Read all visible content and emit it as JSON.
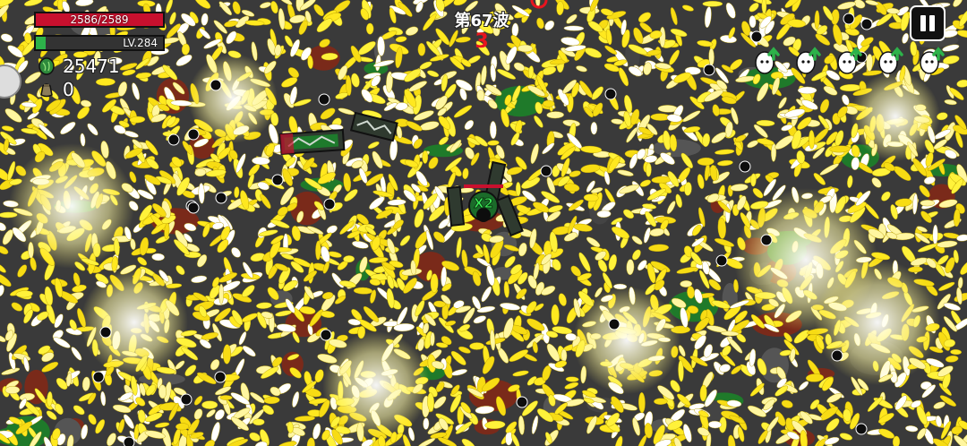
{
  "hud": {
    "hp_text": "2586/2589",
    "hp_fraction": 0.9988,
    "level_text": "LV.284",
    "xp_fraction": 0.08,
    "gems": "25471",
    "bags": "0"
  },
  "wave": {
    "label": "第67波",
    "countdown": "3"
  },
  "upgrades": [
    {
      "icon": "egg-upgrade-arrow-icon"
    },
    {
      "icon": "egg-upgrade-arrow-icon"
    },
    {
      "icon": "egg-upgrade-arrow-icon"
    },
    {
      "icon": "egg-upgrade-arrow-icon"
    },
    {
      "icon": "egg-upgrade-arrow-icon"
    }
  ],
  "player": {
    "multiplier": "X2"
  },
  "colors": {
    "hp": "#c8102e",
    "xp": "#2db24a",
    "projectile": "#ffec3a",
    "arena_floor": "#3a3a3a",
    "enemy": "#0d0d0d"
  }
}
